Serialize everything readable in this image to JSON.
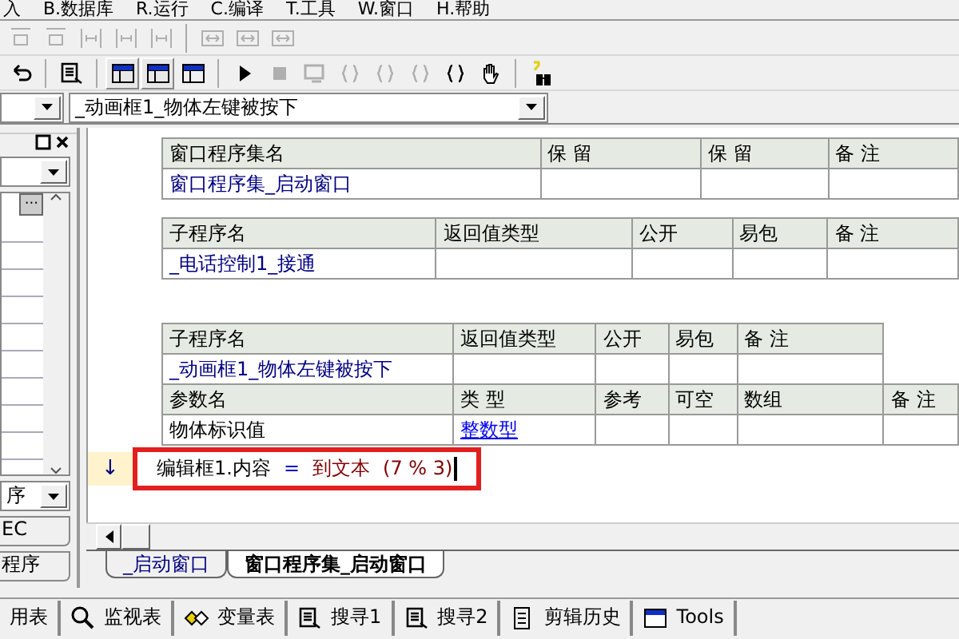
{
  "menu": [
    "入",
    "B.数据库",
    "R.运行",
    "C.编译",
    "T.工具",
    "W.窗口",
    "H.帮助"
  ],
  "toolbars": [
    {
      "items": [
        {
          "kind": "align",
          "disabled": true
        },
        {
          "kind": "align",
          "disabled": true
        },
        {
          "kind": "spacing",
          "disabled": true
        },
        {
          "kind": "spacing",
          "disabled": true
        },
        {
          "kind": "spacing",
          "disabled": true
        },
        {
          "kind": "separator"
        },
        {
          "kind": "resize",
          "disabled": true
        },
        {
          "kind": "resize",
          "disabled": true
        },
        {
          "kind": "resize",
          "disabled": true
        }
      ]
    },
    {
      "items": [
        {
          "kind": "undo",
          "disabled": false
        },
        {
          "kind": "separator"
        },
        {
          "kind": "find",
          "disabled": false
        },
        {
          "kind": "separator"
        },
        {
          "kind": "layout",
          "disabled": false,
          "pressed": true
        },
        {
          "kind": "layout",
          "disabled": false,
          "pressed": true
        },
        {
          "kind": "layout",
          "disabled": false,
          "pressed": false
        },
        {
          "kind": "separator"
        },
        {
          "kind": "run",
          "disabled": false
        },
        {
          "kind": "stop",
          "disabled": true
        },
        {
          "kind": "debug",
          "disabled": true
        },
        {
          "kind": "brace",
          "disabled": true
        },
        {
          "kind": "brace",
          "disabled": true
        },
        {
          "kind": "brace",
          "disabled": true
        },
        {
          "kind": "brace",
          "disabled": false
        },
        {
          "kind": "hand",
          "disabled": false
        },
        {
          "kind": "separator"
        },
        {
          "kind": "help",
          "disabled": false
        }
      ]
    }
  ],
  "subroutine_combo": {
    "value": "_动画框1_物体左键被按下"
  },
  "left_panel": {
    "more_button": "···",
    "bottom_combo": "序",
    "tabs": [
      "EC",
      "程序"
    ]
  },
  "tables": [
    {
      "rows": [
        {
          "kind": "header",
          "cells": [
            "窗口程序集名",
            "保 留",
            "保 留",
            "备 注"
          ]
        },
        {
          "kind": "data",
          "cells": [
            {
              "text": "窗口程序集_启动窗口",
              "kind": "name"
            }
          ]
        }
      ]
    },
    {
      "rows": [
        {
          "kind": "header",
          "cells": [
            "子程序名",
            "返回值类型",
            "公开",
            "易包",
            "备 注"
          ]
        },
        {
          "kind": "data",
          "cells": [
            {
              "text": "_电话控制1_接通",
              "kind": "name"
            }
          ]
        }
      ]
    },
    {
      "rows": [
        {
          "kind": "header",
          "cells": [
            "子程序名",
            "返回值类型",
            "公开",
            "易包",
            "备 注"
          ]
        },
        {
          "kind": "data",
          "cells": [
            {
              "text": "_动画框1_物体左键被按下",
              "kind": "name"
            }
          ]
        },
        {
          "kind": "header",
          "cells": [
            "参数名",
            "类 型",
            "参考",
            "可空",
            "数组",
            "备 注"
          ]
        },
        {
          "kind": "data",
          "cells": [
            {
              "text": "物体标识值",
              "kind": "plain"
            },
            {
              "text": "整数型",
              "kind": "link"
            }
          ]
        }
      ]
    }
  ],
  "code_line": {
    "marker": "↓",
    "highlighted": true,
    "cursor": true,
    "tokens": [
      {
        "text": "编辑框1.内容",
        "kind": "name"
      },
      {
        "text": "=",
        "kind": "operator"
      },
      {
        "text": "到文本",
        "kind": "function"
      },
      {
        "text": "(7 % 3)",
        "kind": "args"
      }
    ]
  },
  "document_tabs": [
    {
      "label": "_启动窗口",
      "selected": false
    },
    {
      "label": "窗口程序集_启动窗口",
      "selected": true
    }
  ],
  "bottom_tabs": [
    {
      "label": "用表",
      "kind": "none"
    },
    {
      "label": "监视表",
      "kind": "magnifier"
    },
    {
      "label": "变量表",
      "kind": "diamonds"
    },
    {
      "label": "搜寻1",
      "kind": "doc-search"
    },
    {
      "label": "搜寻2",
      "kind": "doc-search"
    },
    {
      "label": "剪辑历史",
      "kind": "document"
    },
    {
      "label": "Tools",
      "kind": "window"
    }
  ]
}
